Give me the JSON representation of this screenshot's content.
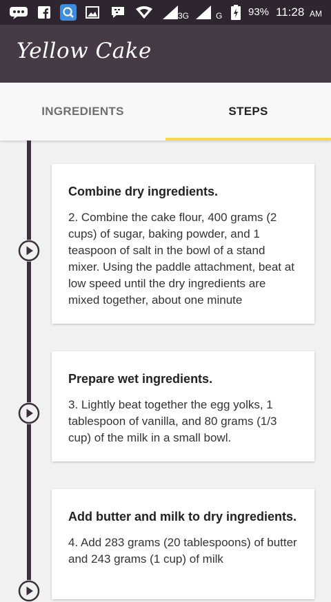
{
  "status_bar": {
    "battery_percent": "93%",
    "time": "11:28",
    "time_suffix": "AM",
    "network_3g": "3G",
    "network_g": "G"
  },
  "app_bar": {
    "title": "Yellow Cake"
  },
  "tabs": [
    {
      "label": "INGREDIENTS",
      "active": false
    },
    {
      "label": "STEPS",
      "active": true
    }
  ],
  "accent_color": "#f5d94a",
  "steps": [
    {
      "title": "Combine dry ingredients.",
      "body": "2. Combine the cake flour, 400 grams (2 cups) of sugar, baking powder, and 1 teaspoon of salt in the bowl of a stand mixer. Using the paddle attachment, beat at low speed until the dry ingredients are mixed together, about one minute"
    },
    {
      "title": "Prepare wet ingredients.",
      "body": "3. Lightly beat together the egg yolks, 1 tablespoon of vanilla, and 80 grams (1/3 cup) of the milk in a small bowl."
    },
    {
      "title": "Add butter and milk to dry ingredients.",
      "body": "4. Add 283 grams (20 tablespoons) of butter and 243 grams (1 cup) of milk"
    }
  ]
}
